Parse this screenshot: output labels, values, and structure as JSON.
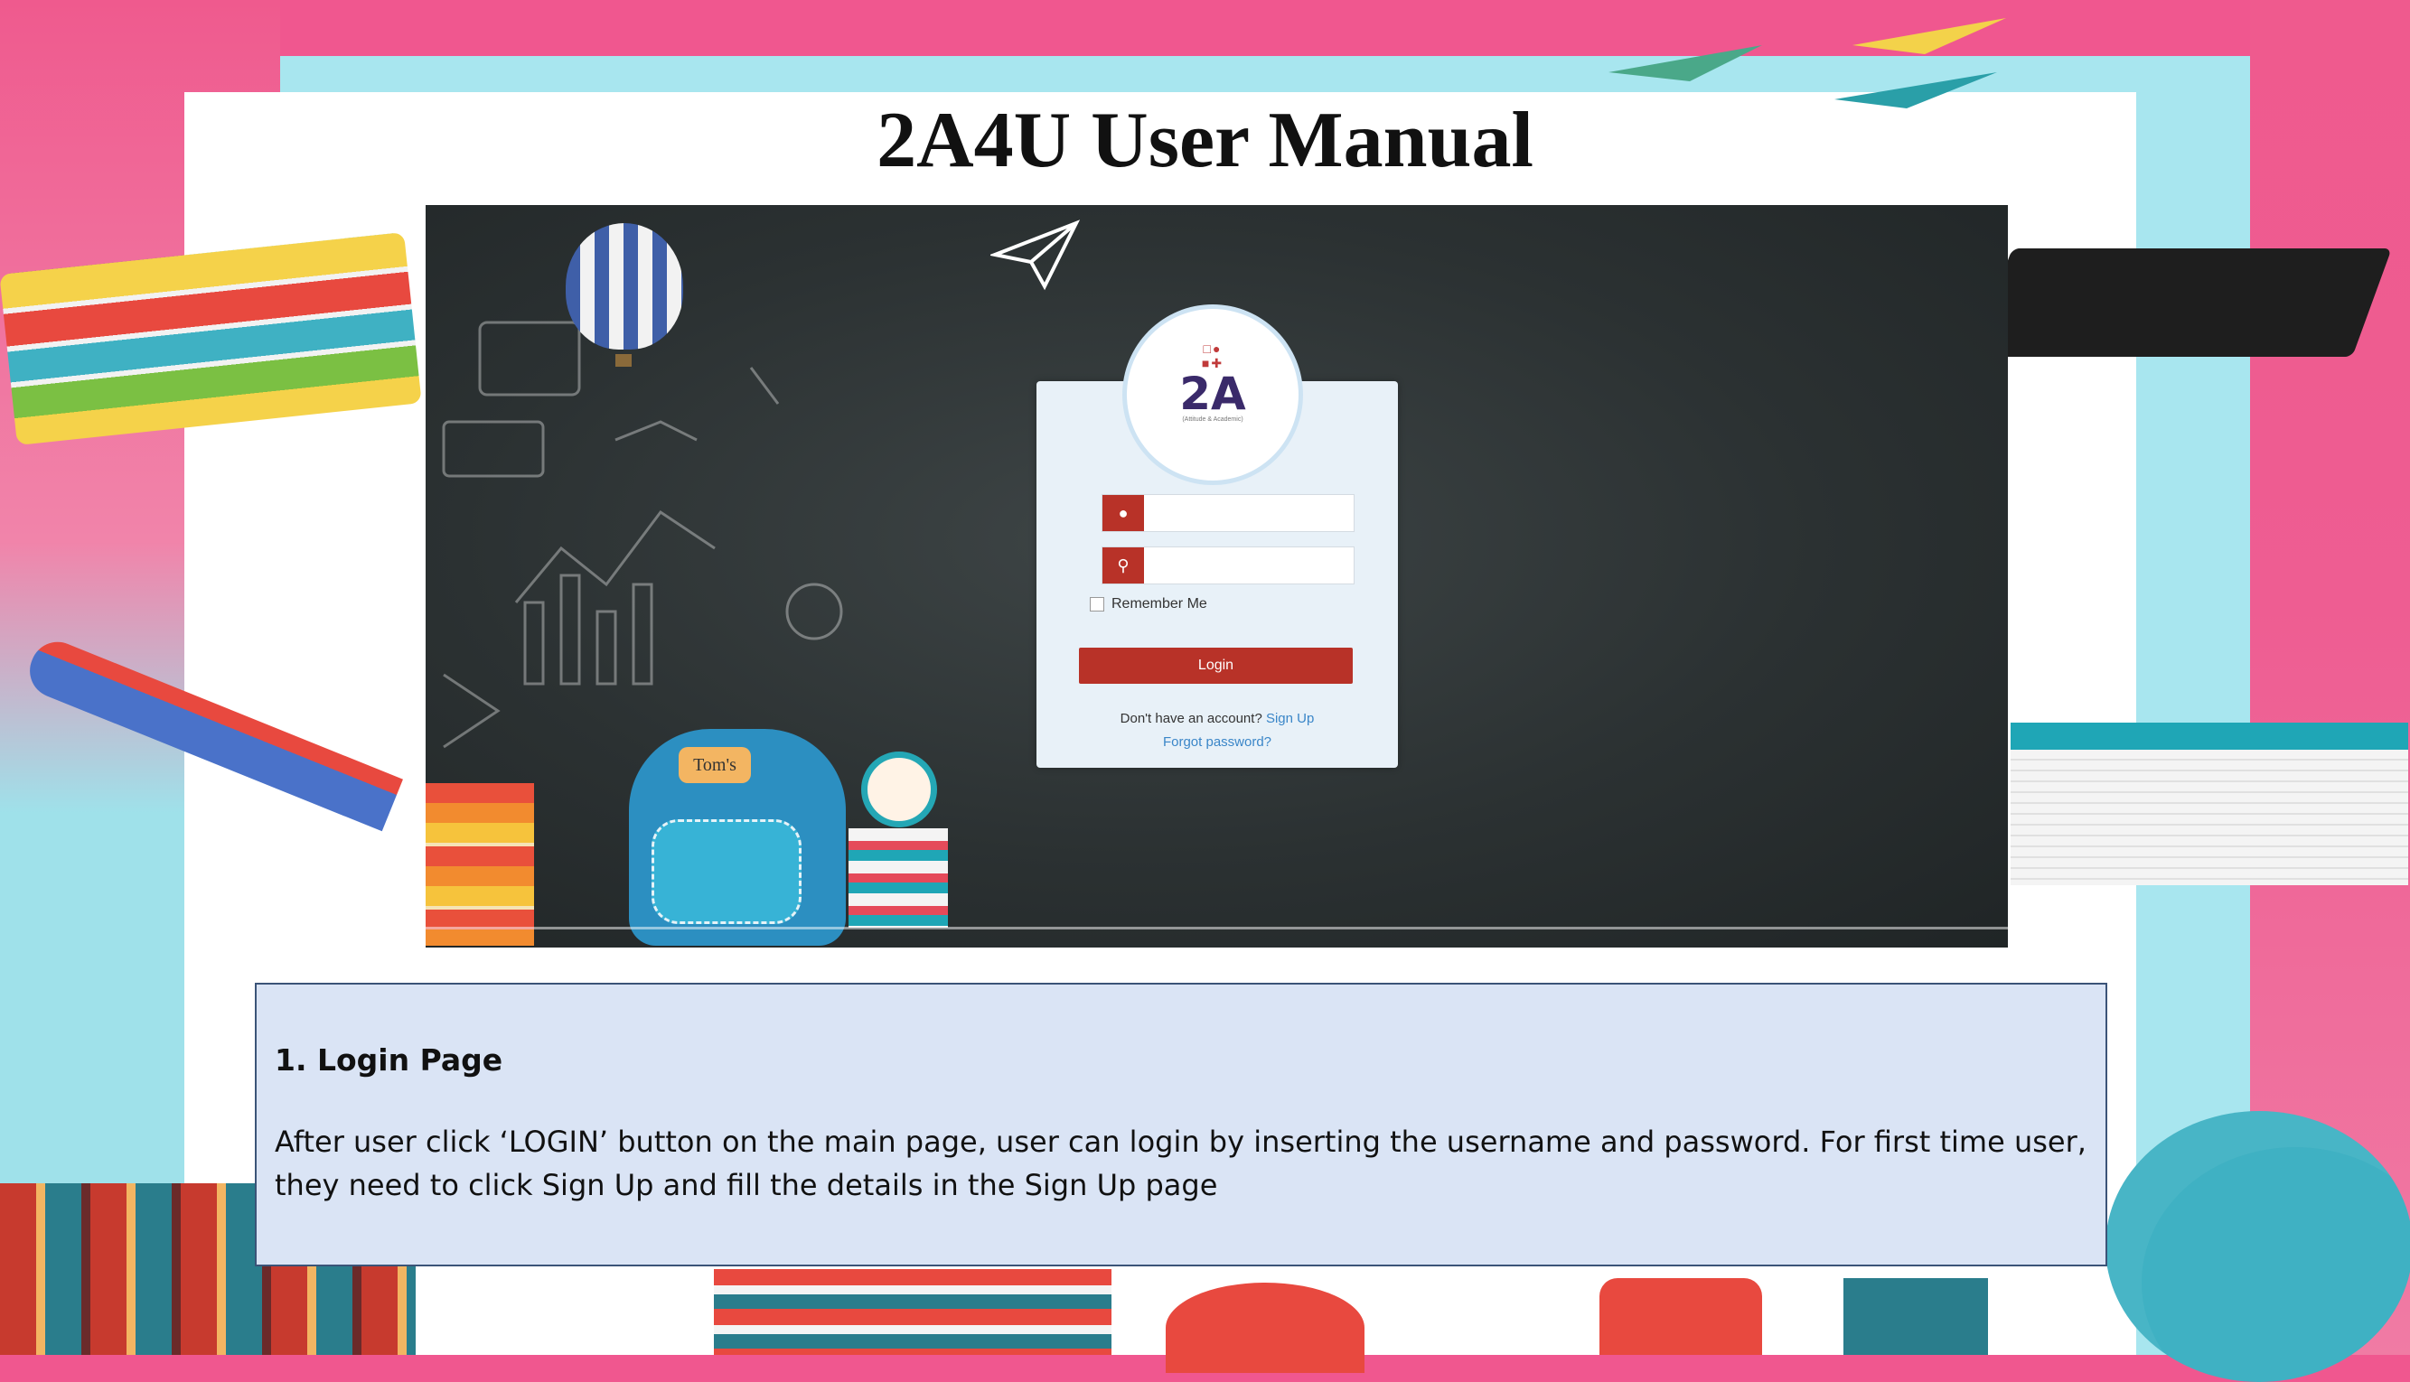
{
  "title": "2A4U User Manual",
  "screenshot": {
    "logo": {
      "text": "2A",
      "tagline": "(Attitude & Academic)"
    },
    "username_placeholder": "",
    "password_placeholder": "",
    "remember_label": "Remember Me",
    "login_button": "Login",
    "no_account_text": "Don't have an account?",
    "signup_link": "Sign Up",
    "forgot_link": "Forgot password?",
    "bag_tag": "Tom's",
    "icons": {
      "username": "user-icon",
      "password": "key-icon"
    }
  },
  "description": {
    "heading": "1.  Login Page",
    "body": "After user click ‘LOGIN’ button on the main page, user can login by inserting the username and password. For first time user, they need to click Sign Up and fill the details in the Sign Up page"
  },
  "colors": {
    "accent_red": "#b83228",
    "link_blue": "#3a86c8",
    "frame_pink": "#f0578f",
    "frame_cyan": "#a8e6ef",
    "desc_box": "#dae4f5"
  }
}
